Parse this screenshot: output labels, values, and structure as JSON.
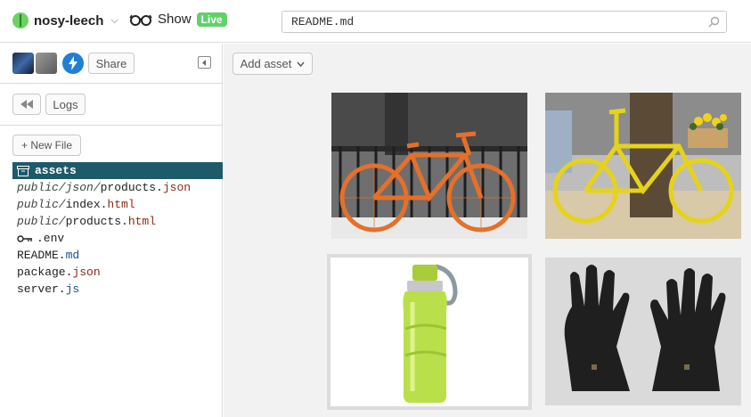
{
  "header": {
    "project_name": "nosy-leech",
    "show_label": "Show",
    "live_badge": "Live",
    "search_value": "README.md"
  },
  "sidebar": {
    "share_label": "Share",
    "logs_label": "Logs",
    "new_file_label": "+ New File",
    "files": {
      "assets": "assets",
      "f1": {
        "dir1": "public/",
        "dir2": "json/",
        "name": "products.",
        "ext": "json"
      },
      "f2": {
        "dir": "public/",
        "name": "index.",
        "ext": "html"
      },
      "f3": {
        "dir": "public/",
        "name": "products.",
        "ext": "html"
      },
      "f4": {
        "name": ".env"
      },
      "f5": {
        "name": "README.",
        "ext": "md"
      },
      "f6": {
        "name": "package.",
        "ext": "json"
      },
      "f7": {
        "name": "server.",
        "ext": "js"
      }
    }
  },
  "main": {
    "add_asset_label": "Add asset",
    "assets": [
      {
        "subject": "orange-bicycle"
      },
      {
        "subject": "yellow-bicycle-with-flowers"
      },
      {
        "subject": "green-water-bottle"
      },
      {
        "subject": "black-gloves"
      }
    ]
  },
  "colors": {
    "accent_selected": "#1d5a6a",
    "live_badge": "#5fd26a",
    "boost_blue": "#1f7fd6"
  }
}
